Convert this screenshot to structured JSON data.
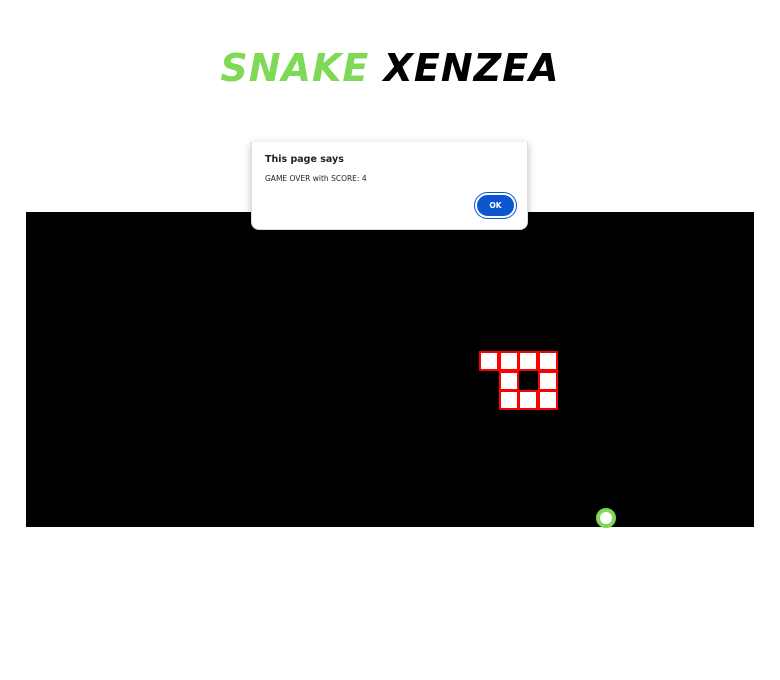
{
  "header": {
    "title_part1": "SNAKE",
    "title_part2": "XENZEA"
  },
  "alert": {
    "title": "This page says",
    "message": "GAME OVER with SCORE: 4",
    "ok_label": "OK"
  },
  "game": {
    "grid_cell": "20",
    "snake_segments": [
      {
        "col": 0,
        "row": 0
      },
      {
        "col": 1,
        "row": 0
      },
      {
        "col": 2,
        "row": 0
      },
      {
        "col": 3,
        "row": 0
      },
      {
        "col": 1,
        "row": 1
      },
      {
        "col": 3,
        "row": 1
      },
      {
        "col": 1,
        "row": 2
      },
      {
        "col": 2,
        "row": 2
      },
      {
        "col": 3,
        "row": 2
      }
    ],
    "colors": {
      "board": "#000000",
      "snake_fill": "#ffffff",
      "snake_border": "#ff0000",
      "food_border": "#7ed957",
      "title_accent": "#7ed957",
      "ok_button": "#0b57d0"
    }
  }
}
